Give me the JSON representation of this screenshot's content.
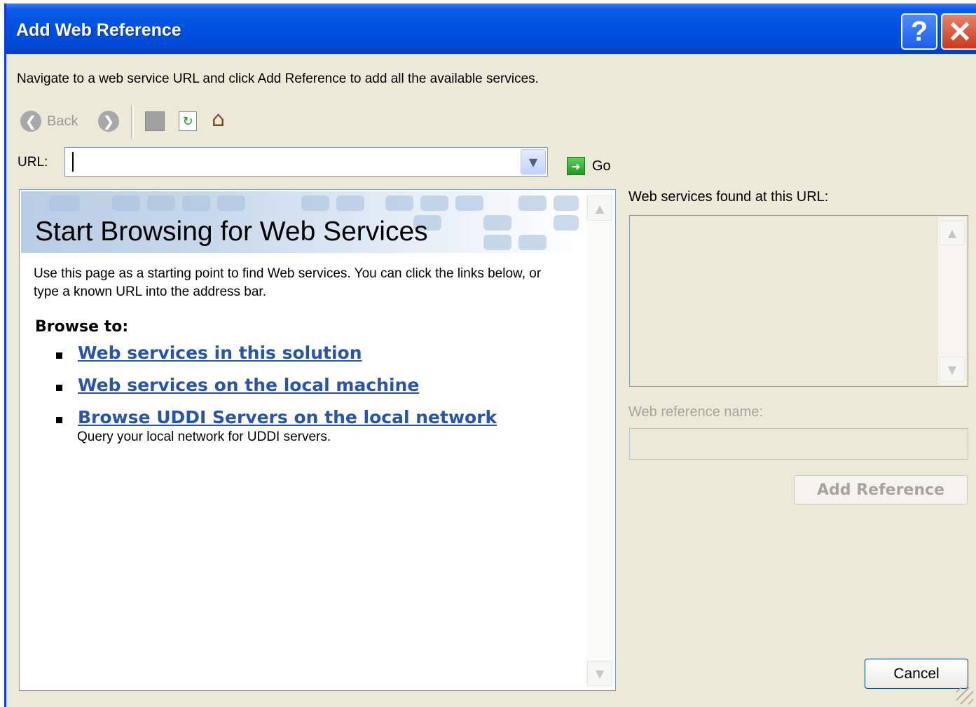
{
  "window": {
    "title": "Add Web Reference",
    "help_label": "?",
    "close_label": "✕"
  },
  "instruction": "Navigate to a web service URL and click Add Reference to add all the available services.",
  "toolbar": {
    "back_label": "Back"
  },
  "url": {
    "label": "URL:",
    "value": "",
    "placeholder": ""
  },
  "go": {
    "label": "Go"
  },
  "browser": {
    "title": "Start Browsing for Web Services",
    "intro": "Use this page as a starting point to find Web services. You can click the links below, or type a known URL into the address bar.",
    "browse_to": "Browse to:",
    "links": [
      {
        "label": "Web services in this solution"
      },
      {
        "label": "Web services on the local machine"
      },
      {
        "label": "Browse UDDI Servers on the local network"
      }
    ],
    "link_description": "Query your local network for UDDI servers."
  },
  "found_label": "Web services found at this URL:",
  "refname": {
    "label": "Web reference name:",
    "value": ""
  },
  "add_reference_label": "Add Reference",
  "cancel_label": "Cancel",
  "colors": {
    "title_bar": "#0050e0",
    "link": "#2855a8",
    "dialog_bg": "#ece9d8"
  }
}
